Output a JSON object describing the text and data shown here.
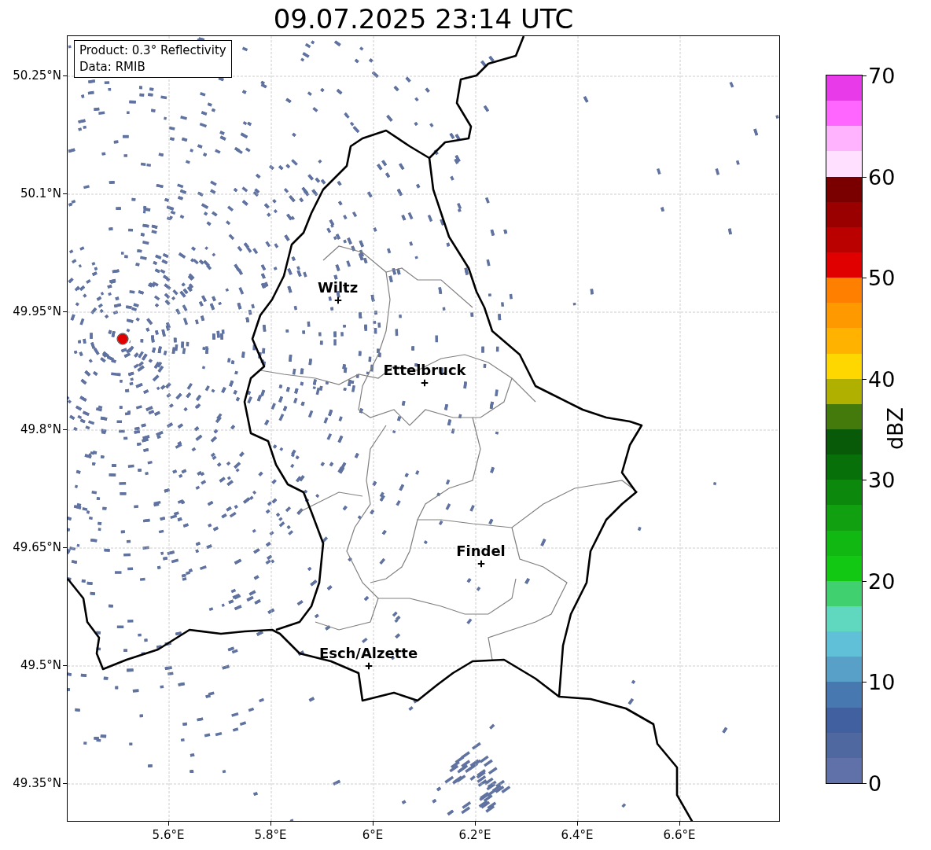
{
  "title": "09.07.2025 23:14 UTC",
  "info_box": [
    "Product: 0.3° Reflectivity",
    "Data: RMIB"
  ],
  "map": {
    "cities": [
      {
        "name": "Wiltz"
      },
      {
        "name": "Ettelbruck"
      },
      {
        "name": "Findel"
      },
      {
        "name": "Esch/Alzette"
      }
    ],
    "lat_ticks": [
      "50.25°N",
      "50.1°N",
      "49.95°N",
      "49.8°N",
      "49.65°N",
      "49.5°N",
      "49.35°N"
    ],
    "lon_ticks": [
      "5.6°E",
      "5.8°E",
      "6°E",
      "6.2°E",
      "6.4°E",
      "6.6°E"
    ]
  },
  "colorbar": {
    "label": "dBZ",
    "ticks": [
      "70",
      "60",
      "50",
      "40",
      "30",
      "20",
      "10",
      "0"
    ],
    "bands": [
      {
        "color": "#e93ae9"
      },
      {
        "color": "#ff66ff"
      },
      {
        "color": "#ffb3ff"
      },
      {
        "color": "#ffe0ff"
      },
      {
        "color": "#7a0000"
      },
      {
        "color": "#9a0000"
      },
      {
        "color": "#bb0000"
      },
      {
        "color": "#e00000"
      },
      {
        "color": "#ff7f00"
      },
      {
        "color": "#ff9900"
      },
      {
        "color": "#ffb300"
      },
      {
        "color": "#ffd700"
      },
      {
        "color": "#b0b000"
      },
      {
        "color": "#447a0c"
      },
      {
        "color": "#085a08"
      },
      {
        "color": "#087008"
      },
      {
        "color": "#0c880c"
      },
      {
        "color": "#10a010"
      },
      {
        "color": "#12b812"
      },
      {
        "color": "#12c812"
      },
      {
        "color": "#40d070"
      },
      {
        "color": "#60d8c0"
      },
      {
        "color": "#60c0d8"
      },
      {
        "color": "#58a0c8"
      },
      {
        "color": "#4878b0"
      },
      {
        "color": "#4060a0"
      },
      {
        "color": "#5068a0"
      },
      {
        "color": "#6070a8"
      }
    ]
  }
}
